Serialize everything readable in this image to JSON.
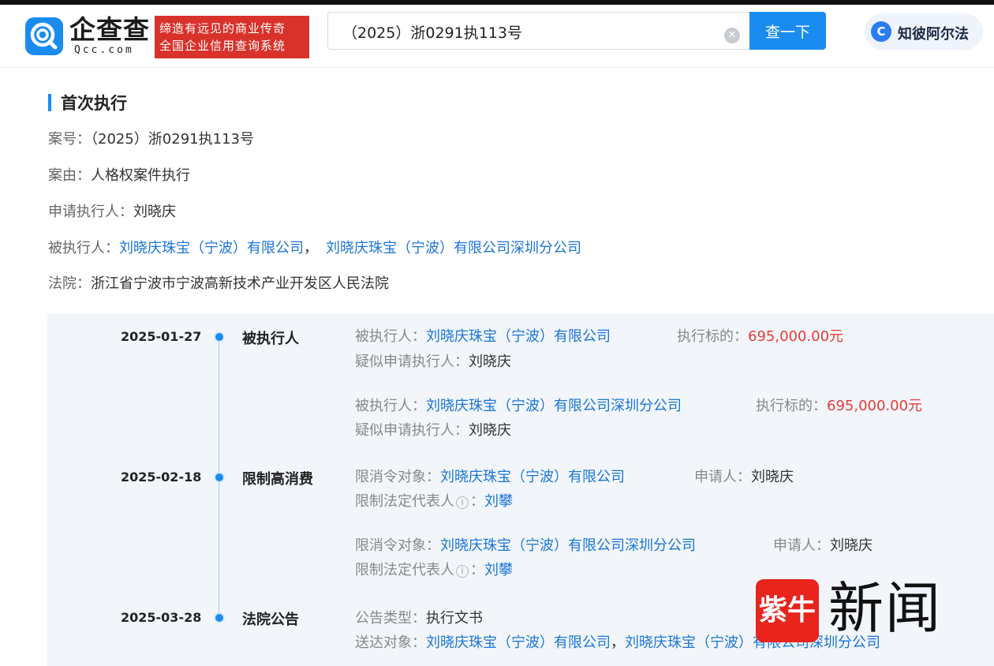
{
  "header": {
    "logo_text": "企查查",
    "logo_sub": "Qcc.com",
    "slogan_line1": "缔造有远见的商业传奇",
    "slogan_line2": "全国企业信用查询系统",
    "search_value": "（2025）浙0291执113号",
    "search_button": "查一下",
    "ai_label": "知彼阿尔法",
    "ai_icon": "C"
  },
  "section": {
    "title": "首次执行"
  },
  "case_info": {
    "case_no_key": "案号：",
    "case_no_val": "（2025）浙0291执113号",
    "cause_key": "案由：",
    "cause_val": "人格权案件执行",
    "applicant_key": "申请执行人：",
    "applicant_val": "刘晓庆",
    "respondent_key": "被执行人：",
    "respondent_1": "刘晓庆珠宝（宁波）有限公司",
    "respondent_sep": "，",
    "respondent_2": "刘晓庆珠宝（宁波）有限公司深圳分公司",
    "court_key": "法院：",
    "court_val": "浙江省宁波市宁波高新技术产业开发区人民法院"
  },
  "timeline": {
    "e1_date": "2025-01-27",
    "e1_type": "被执行人",
    "e1_r1_k1": "被执行人：",
    "e1_r1_v1": "刘晓庆珠宝（宁波）有限公司",
    "e1_r1_k2": "执行标的：",
    "e1_r1_v2": "695,000.00元",
    "e1_r1_k3": "疑似申请执行人：",
    "e1_r1_v3": "刘晓庆",
    "e1_r2_k1": "被执行人：",
    "e1_r2_v1": "刘晓庆珠宝（宁波）有限公司深圳分公司",
    "e1_r2_k2": "执行标的：",
    "e1_r2_v2": "695,000.00元",
    "e1_r2_k3": "疑似申请执行人：",
    "e1_r2_v3": "刘晓庆",
    "e2_date": "2025-02-18",
    "e2_type": "限制高消费",
    "e2_r1_k1": "限消令对象：",
    "e2_r1_v1": "刘晓庆珠宝（宁波）有限公司",
    "e2_r1_k2": "申请人：",
    "e2_r1_v2": "刘晓庆",
    "e2_r1_k3": "限制法定代表人",
    "e2_r1_v3": "刘攀",
    "e2_r2_k1": "限消令对象：",
    "e2_r2_v1": "刘晓庆珠宝（宁波）有限公司深圳分公司",
    "e2_r2_k2": "申请人：",
    "e2_r2_v2": "刘晓庆",
    "e2_r2_k3": "限制法定代表人",
    "e2_r2_v3": "刘攀",
    "info_glyph": "i",
    "info_colon": "：",
    "e3_date": "2025-03-28",
    "e3_type": "法院公告",
    "e3_k1": "公告类型：",
    "e3_v1": "执行文书",
    "e3_k2": "送达对象：",
    "e3_v2a": "刘晓庆珠宝（宁波）有限公司",
    "e3_sep": "，",
    "e3_v2b": "刘晓庆珠宝（宁波）有限公司深圳分公司"
  },
  "watermark": {
    "logo": "紫牛",
    "text": "新闻"
  }
}
